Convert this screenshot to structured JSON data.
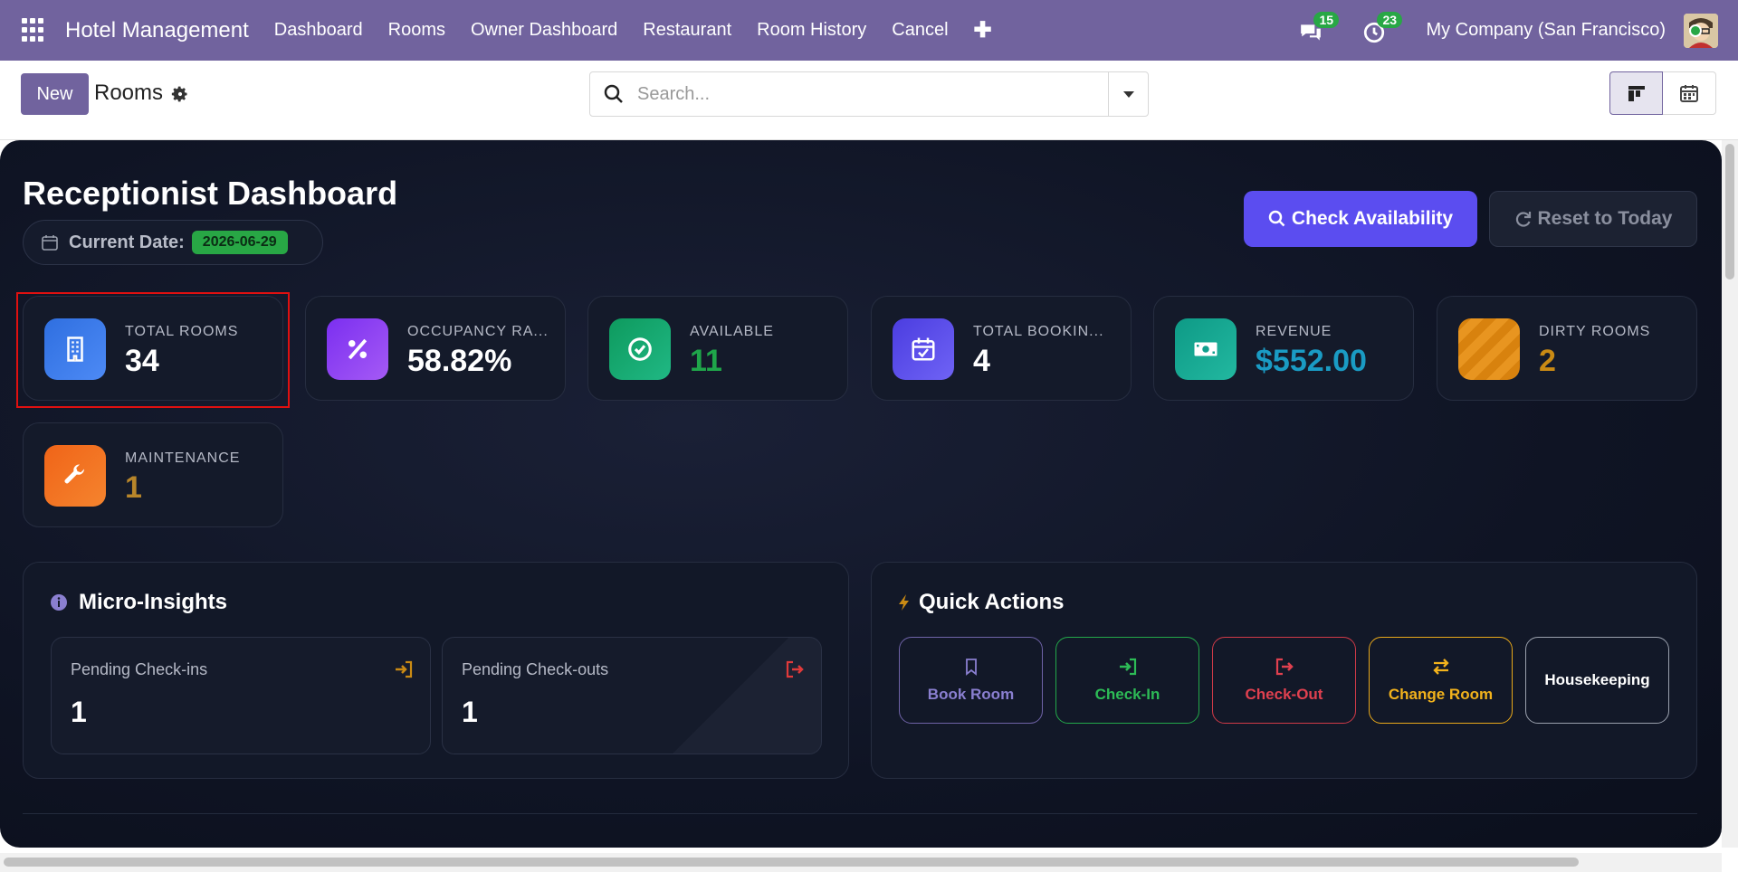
{
  "navbar": {
    "brand": "Hotel Management",
    "menu": [
      "Dashboard",
      "Rooms",
      "Owner Dashboard",
      "Restaurant",
      "Room History",
      "Cancel"
    ],
    "plus": "✚",
    "messages_count": "15",
    "activities_count": "23",
    "company": "My Company (San Francisco)"
  },
  "control": {
    "new_label": "New",
    "title": "Rooms",
    "search_placeholder": "Search..."
  },
  "dashboard": {
    "title": "Receptionist Dashboard",
    "date_label": "Current Date:",
    "date_value": "2026-06-29",
    "check_label": "Check Availability",
    "reset_label": "Reset to Today",
    "stats": [
      {
        "label": "TOTAL ROOMS",
        "value": "34",
        "color": "#ffffff",
        "icon": "building-icon",
        "bg": "#2f6fe0"
      },
      {
        "label": "OCCUPANCY RATE",
        "value": "58.82%",
        "color": "#ffffff",
        "icon": "percent-icon",
        "bg": "#8b3ff0"
      },
      {
        "label": "AVAILABLE",
        "value": "11",
        "color": "#1fa64a",
        "icon": "check-circle-icon",
        "bg": "#14a06a"
      },
      {
        "label": "TOTAL BOOKINGS",
        "value": "4",
        "color": "#ffffff",
        "icon": "calendar-check-icon",
        "bg": "#5b4df0"
      },
      {
        "label": "REVENUE",
        "value": "$552.00",
        "color": "#1a9bc4",
        "icon": "money-icon",
        "bg": "#12a08e"
      },
      {
        "label": "DIRTY ROOMS",
        "value": "2",
        "color": "#c98a14",
        "icon": "dirty-icon",
        "bg": "#e08a10"
      },
      {
        "label": "MAINTENANCE",
        "value": "1",
        "color": "#b8862a",
        "icon": "wrench-icon",
        "bg": "#f07020"
      }
    ],
    "insights": {
      "title": "Micro-Insights",
      "pending_checkins_label": "Pending Check-ins",
      "pending_checkins_value": "1",
      "pending_checkouts_label": "Pending Check-outs",
      "pending_checkouts_value": "1"
    },
    "quick_actions": {
      "title": "Quick Actions",
      "book_room": "Book Room",
      "check_in": "Check-In",
      "check_out": "Check-Out",
      "change_room": "Change Room",
      "housekeeping": "Housekeeping"
    }
  }
}
